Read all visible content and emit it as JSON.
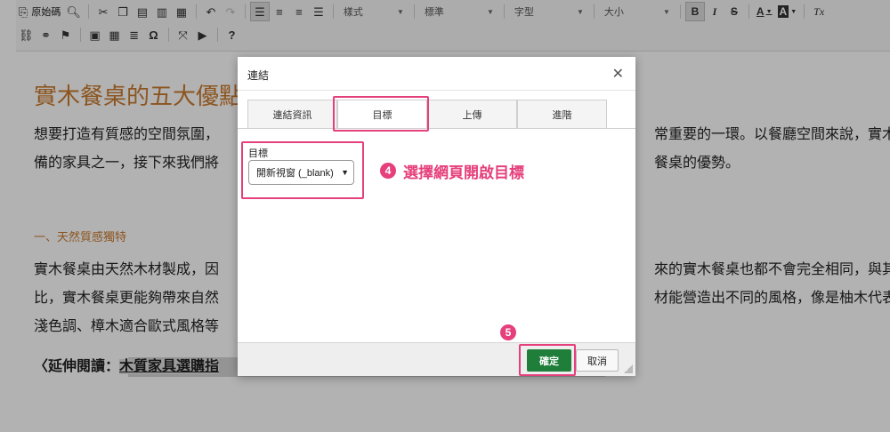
{
  "toolbar": {
    "source_label": "原始碼",
    "combos": {
      "format": "樣式",
      "style": "標準",
      "font": "字型",
      "size": "大小"
    },
    "row1_icons": [
      "source-icon",
      "preview-icon",
      "cut-icon",
      "copy-icon",
      "paste-icon",
      "paste-text-icon",
      "paste-word-icon",
      "undo-icon",
      "redo-icon",
      "align-left-icon",
      "align-center-icon",
      "align-right-icon",
      "align-justify-icon"
    ],
    "format_buttons": {
      "bold": "B",
      "italic": "I",
      "strike": "S",
      "text_color": "A",
      "bg_color": "A",
      "remove_format": "Tx"
    },
    "row2_icons": [
      "link-icon",
      "unlink-icon",
      "anchor-icon",
      "image-icon",
      "table-icon",
      "horizontal-rule-icon",
      "special-char-icon",
      "maximize-icon",
      "youtube-icon",
      "help-icon"
    ]
  },
  "content": {
    "title": "實木餐桌的五大優點",
    "para1_line1": "想要打造有質感的空間氛圍，",
    "para1_line1_right": "常重要的一環。以餐廳空間來說，實木",
    "para1_line2": "備的家具之一，接下來我們將",
    "para1_line2_right": "餐桌的優勢。",
    "subheading": "一、天然質感獨特",
    "para2_line1": "實木餐桌由天然木材製成，因",
    "para2_line1_right": "來的實木餐桌也都不會完全相同，與其",
    "para2_line2": "比，實木餐桌更能夠帶來自然",
    "para2_line2_right": "材能營造出不同的風格，像是柚木代表",
    "para2_line3": "淺色調、樟木適合歐式風格等",
    "ext_read_prefix": "〈延伸閱讀：",
    "ext_read_link": "木質家具選購指"
  },
  "dialog": {
    "title": "連結",
    "close": "✕",
    "tabs": [
      "連結資訊",
      "目標",
      "上傳",
      "進階"
    ],
    "target_label": "目標",
    "target_value": "開新視窗 (_blank)",
    "ok_label": "確定",
    "cancel_label": "取消"
  },
  "annotations": {
    "step4_number": "4",
    "step4_text": "選擇網頁開啟目標",
    "step5_number": "5",
    "color": "#e5407b"
  }
}
